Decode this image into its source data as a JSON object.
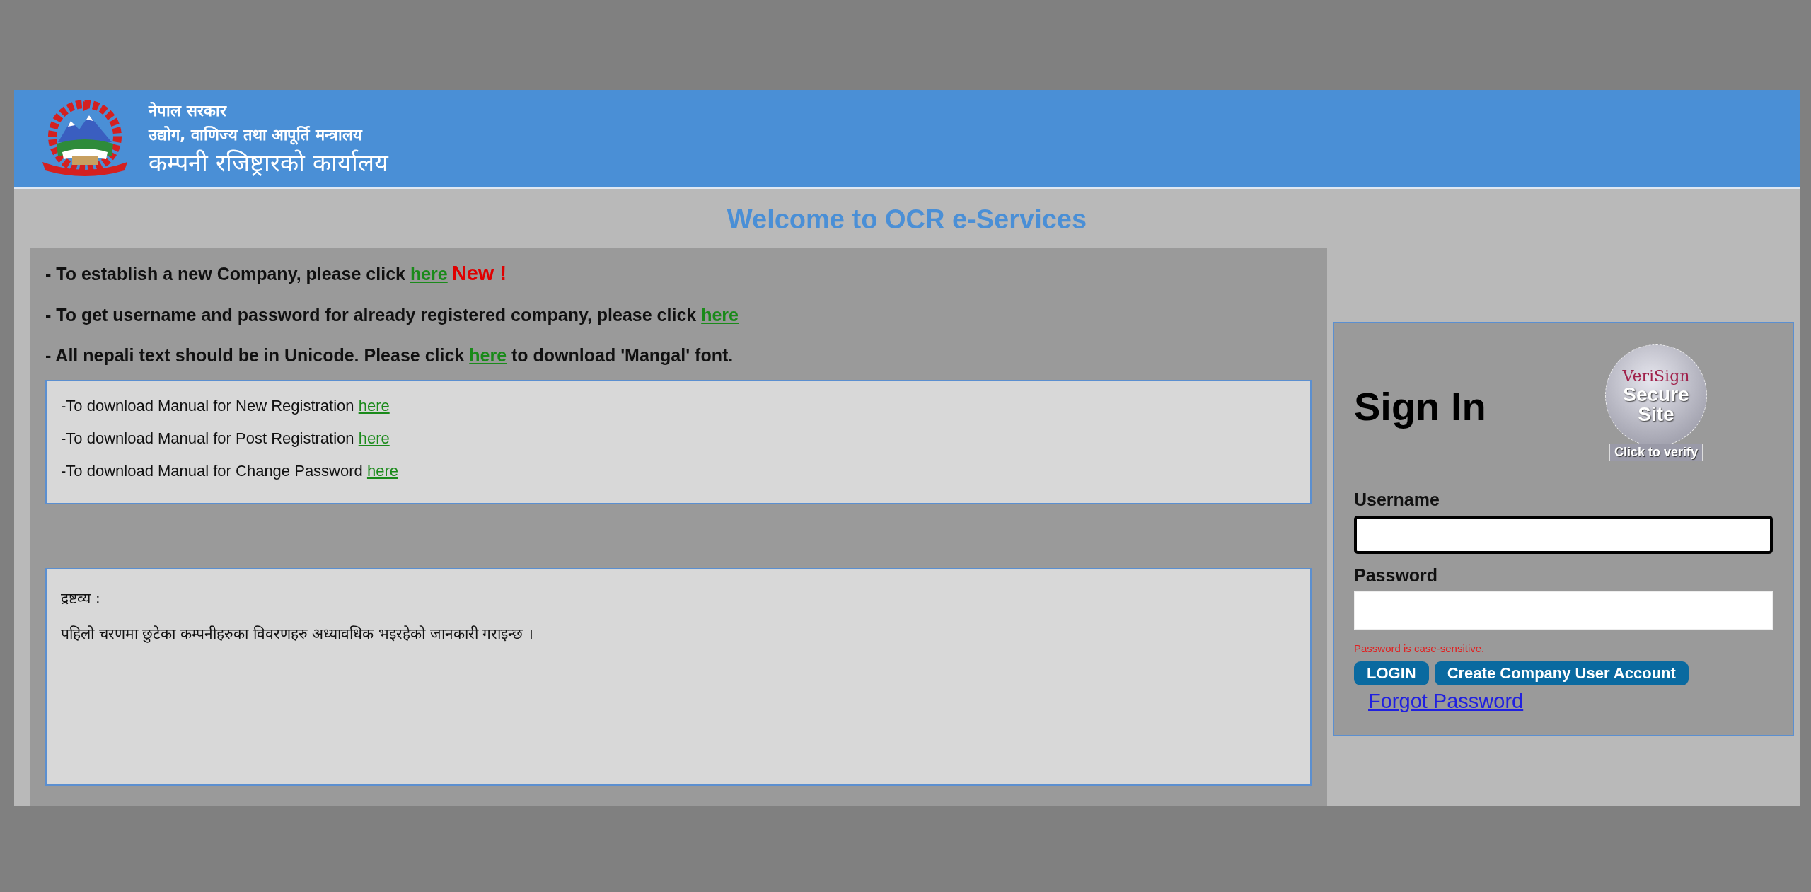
{
  "header": {
    "line_1": "नेपाल सरकार",
    "line_2": "उद्योग, वाणिज्य तथा आपूर्ति मन्त्रालय",
    "line_3": "कम्पनी रजिष्ट्रारको कार्यालय"
  },
  "welcome_title": "Welcome to OCR e-Services",
  "notices": [
    {
      "before": "- To establish a new Company, please click ",
      "link": "here",
      "badge": "New !"
    },
    {
      "before": "- To get username and password for already registered company, please click ",
      "link": "here"
    },
    {
      "before": "- All nepali text should be in Unicode. Please click ",
      "link": "here",
      "after": " to download 'Mangal' font."
    }
  ],
  "manuals": [
    {
      "before": "-To download Manual for New Registration ",
      "link": "here"
    },
    {
      "before": "-To download Manual for Post Registration ",
      "link": "here"
    },
    {
      "before": "-To download Manual for Change Password ",
      "link": "here"
    }
  ],
  "note": {
    "heading": "द्रष्टव्य :",
    "body": "पहिलो चरणमा छुटेका कम्पनीहरुका विवरणहरु अध्यावधिक भइरहेको जानकारी गराइन्छ ।"
  },
  "sign_in": {
    "title": "Sign In",
    "seal": {
      "brand": "VeriSign",
      "line_1": "Secure",
      "line_2": "Site",
      "caption": "Click to verify"
    },
    "fields": [
      {
        "label": "Username",
        "focused": true
      },
      {
        "label": "Password",
        "focused": false
      }
    ],
    "hint": "Password is case-sensitive.",
    "buttons": [
      "LOGIN",
      "Create Company User Account"
    ],
    "forgot_link": "Forgot Password"
  }
}
